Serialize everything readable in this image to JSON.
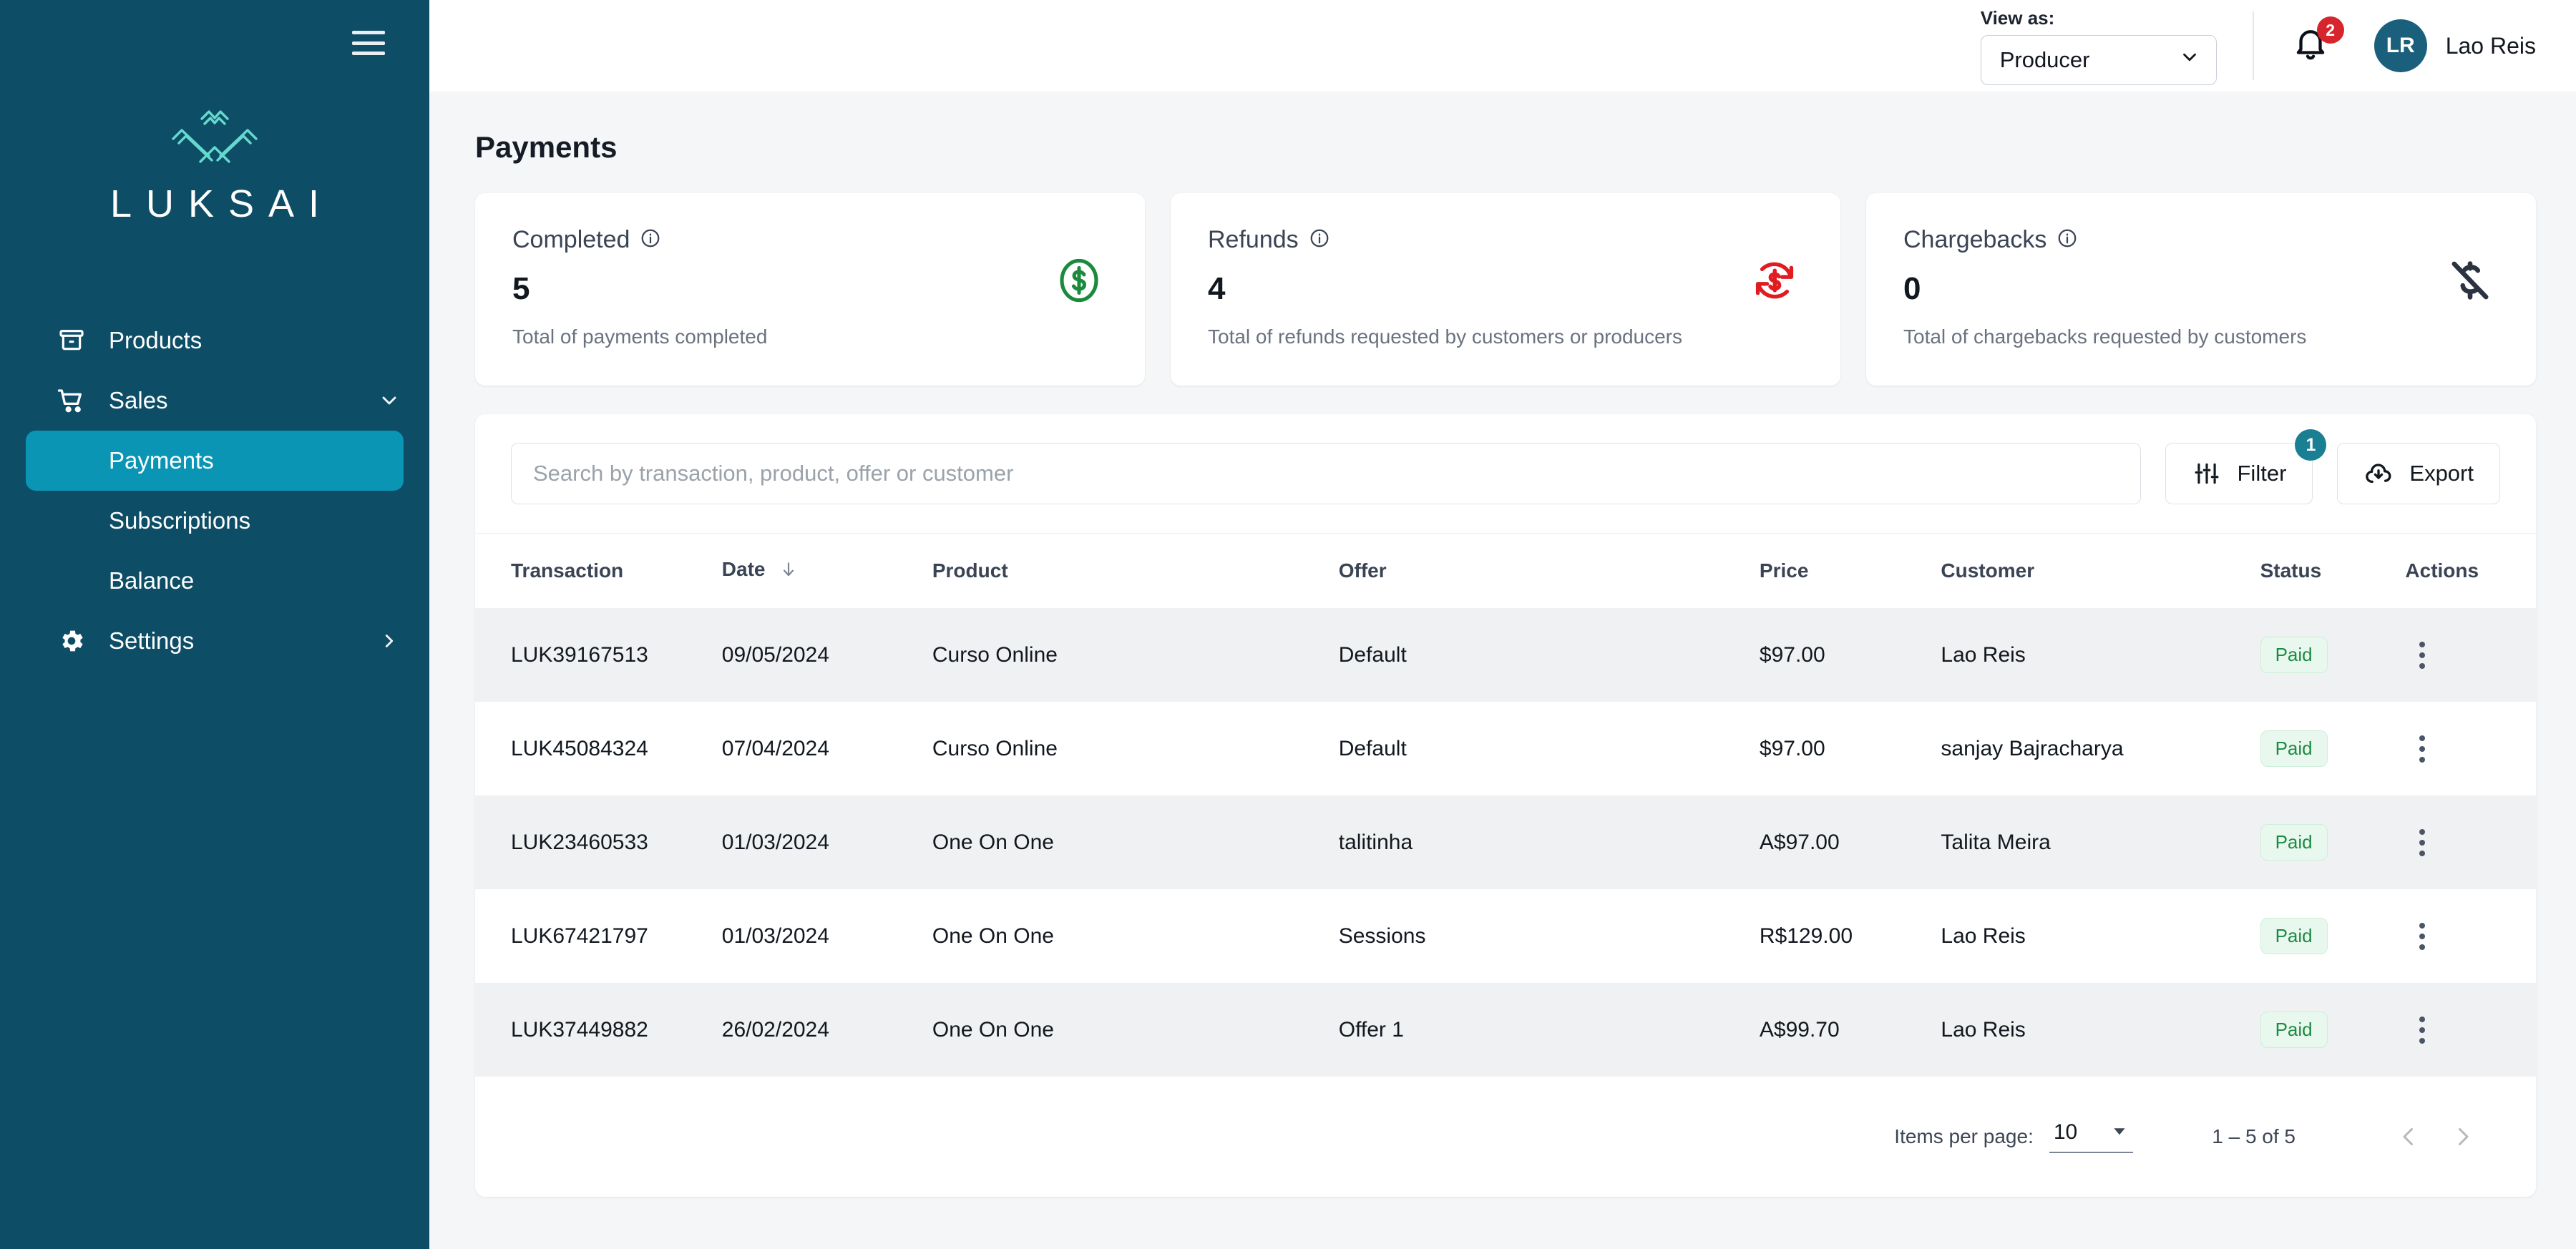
{
  "sidebar": {
    "brand_name": "LUKSAI",
    "menu_icon": "hamburger-menu-icon",
    "items": [
      {
        "label": "Products",
        "icon": "inventory-box-icon",
        "chevron": ""
      },
      {
        "label": "Sales",
        "icon": "shopping-cart-icon",
        "chevron": "chevron-down-icon"
      },
      {
        "label": "Payments",
        "icon": "",
        "chevron": "",
        "active": true
      },
      {
        "label": "Subscriptions",
        "icon": "",
        "chevron": ""
      },
      {
        "label": "Balance",
        "icon": "",
        "chevron": ""
      },
      {
        "label": "Settings",
        "icon": "gear-icon",
        "chevron": "chevron-right-icon"
      }
    ],
    "bg_color": "#0d4d66",
    "active_color": "#0b95b5"
  },
  "topbar": {
    "view_as_label": "View as:",
    "view_as_value": "Producer",
    "view_as_options": [
      "Producer"
    ],
    "notification_count": "2",
    "avatar_initials": "LR",
    "user_name": "Lao Reis",
    "badge_color": "#d6252c",
    "avatar_color": "#1a5f7c"
  },
  "page": {
    "title": "Payments"
  },
  "cards": [
    {
      "title": "Completed",
      "value": "5",
      "subtitle": "Total of payments completed",
      "icon": "dollar-circle-icon",
      "icon_color": "#1a8a3c"
    },
    {
      "title": "Refunds",
      "value": "4",
      "subtitle": "Total of refunds requested by customers or producers",
      "icon": "refund-dollar-icon",
      "icon_color": "#e01c21"
    },
    {
      "title": "Chargebacks",
      "value": "0",
      "subtitle": "Total of chargebacks requested by customers",
      "icon": "money-off-icon",
      "icon_color": "#2b3340"
    }
  ],
  "search": {
    "placeholder": "Search by transaction, product, offer or customer",
    "value": ""
  },
  "actions": {
    "filter_label": "Filter",
    "filter_icon": "tune-sliders-icon",
    "filter_badge": "1",
    "filter_badge_color": "#1a7f93",
    "export_label": "Export",
    "export_icon": "cloud-download-icon"
  },
  "table": {
    "columns": [
      {
        "label": "Transaction",
        "sort": ""
      },
      {
        "label": "Date",
        "sort": "arrow-down-icon"
      },
      {
        "label": "Product",
        "sort": ""
      },
      {
        "label": "Offer",
        "sort": ""
      },
      {
        "label": "Price",
        "sort": ""
      },
      {
        "label": "Customer",
        "sort": ""
      },
      {
        "label": "Status",
        "sort": ""
      },
      {
        "label": "Actions",
        "sort": ""
      }
    ],
    "rows": [
      {
        "transaction": "LUK39167513",
        "date": "09/05/2024",
        "product": "Curso Online",
        "offer": "Default",
        "price": "$97.00",
        "customer": "Lao Reis",
        "status": "Paid"
      },
      {
        "transaction": "LUK45084324",
        "date": "07/04/2024",
        "product": "Curso Online",
        "offer": "Default",
        "price": "$97.00",
        "customer": "sanjay Bajracharya",
        "status": "Paid"
      },
      {
        "transaction": "LUK23460533",
        "date": "01/03/2024",
        "product": "One On One",
        "offer": "talitinha",
        "price": "A$97.00",
        "customer": "Talita Meira",
        "status": "Paid"
      },
      {
        "transaction": "LUK67421797",
        "date": "01/03/2024",
        "product": "One On One",
        "offer": "Sessions",
        "price": "R$129.00",
        "customer": "Lao Reis",
        "status": "Paid"
      },
      {
        "transaction": "LUK37449882",
        "date": "26/02/2024",
        "product": "One On One",
        "offer": "Offer 1",
        "price": "A$99.70",
        "customer": "Lao Reis",
        "status": "Paid"
      }
    ]
  },
  "pagination": {
    "items_per_page_label": "Items per page:",
    "items_per_page_value": "10",
    "range_label": "1 – 5 of 5",
    "prev_icon": "chevron-left-icon",
    "next_icon": "chevron-right-icon"
  }
}
